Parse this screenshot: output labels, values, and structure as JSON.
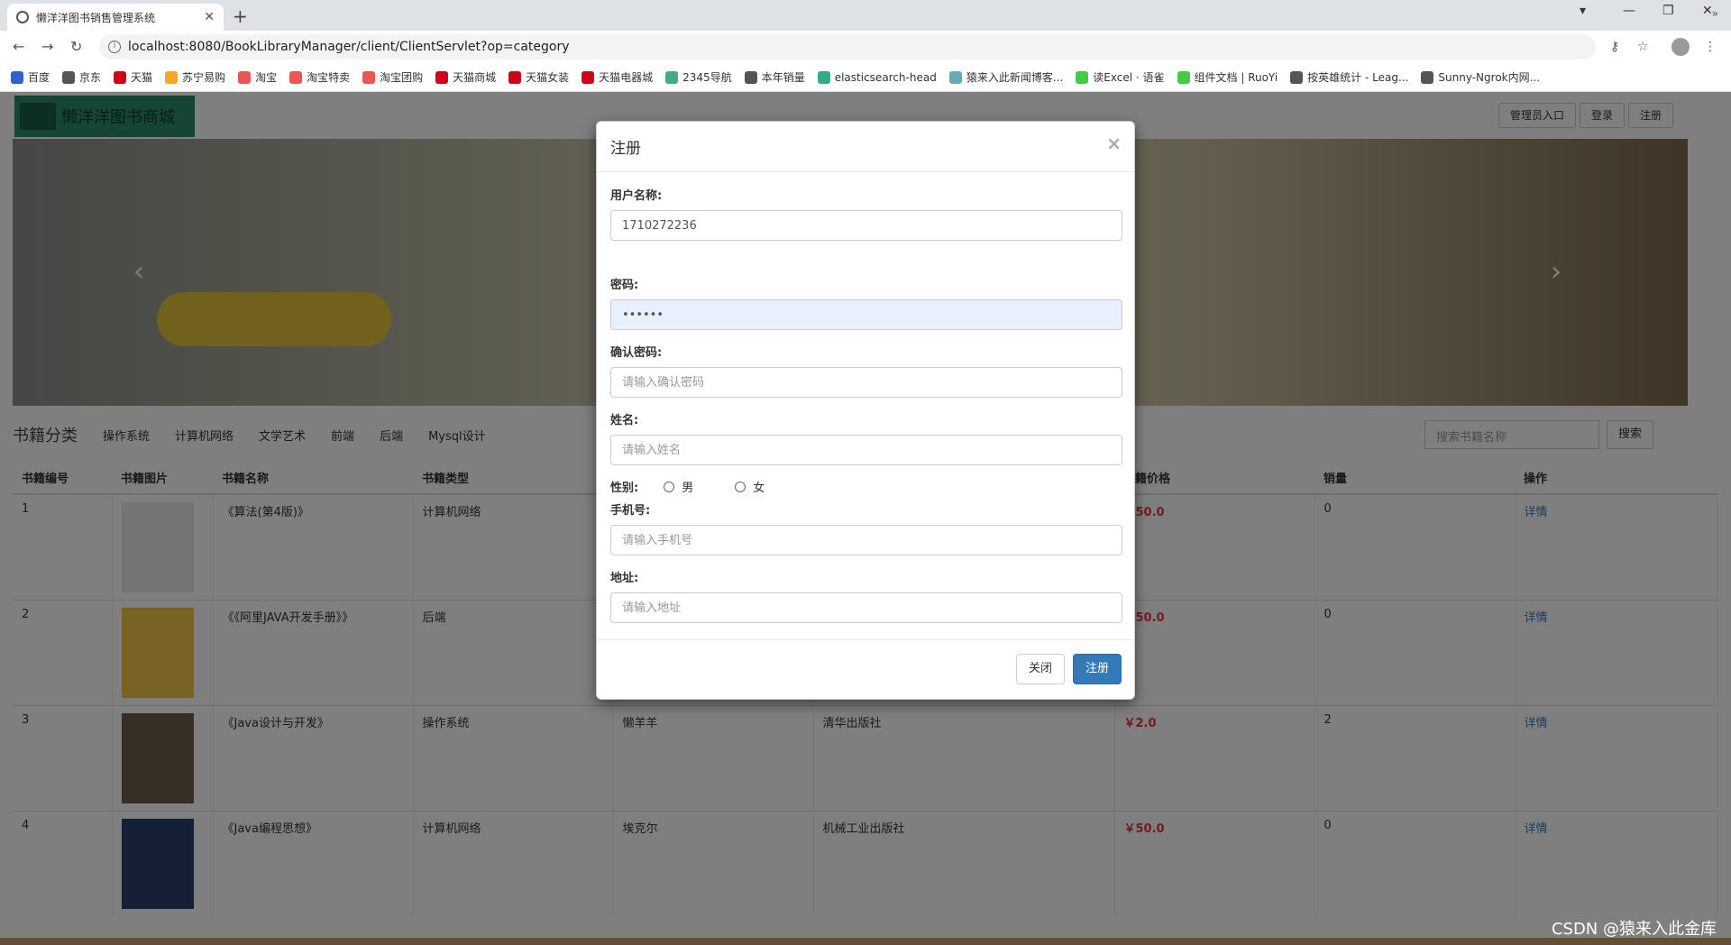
{
  "browser": {
    "tab_title": "懒洋洋图书销售管理系统",
    "url": "localhost:8080/BookLibraryManager/client/ClientServlet?op=category",
    "bookmarks": [
      "百度",
      "京东",
      "天猫",
      "苏宁易购",
      "淘宝",
      "淘宝特卖",
      "淘宝团购",
      "天猫商城",
      "天猫女装",
      "天猫电器城",
      "2345导航",
      "本年销量",
      "elasticsearch-head",
      "猿来入此新闻博客...",
      "读Excel · 语雀",
      "组件文档 | RuoYi",
      "按英雄统计 - Leag...",
      "Sunny-Ngrok内网..."
    ],
    "bookmarks_more": "»"
  },
  "site": {
    "brand": "懒洋洋图书商城",
    "admin_entry": "管理员入口",
    "login": "登录",
    "register": "注册",
    "category_heading": "书籍分类",
    "categories": [
      "操作系统",
      "计算机网络",
      "文学艺术",
      "前端",
      "后端",
      "Mysql设计"
    ],
    "search_placeholder": "搜索书籍名称",
    "search_button": "搜索",
    "table": {
      "headers": [
        "书籍编号",
        "书籍图片",
        "书籍名称",
        "书籍类型",
        "",
        "",
        "书籍价格",
        "销量",
        "操作"
      ],
      "rows": [
        {
          "id": "1",
          "name": "《算法(第4版)》",
          "type": "计算机网络",
          "author": "",
          "publisher": "",
          "price": "￥50.0",
          "sales": "0",
          "action": "详情"
        },
        {
          "id": "2",
          "name": "《《阿里JAVA开发手册》》",
          "type": "后端",
          "author": "",
          "publisher": "",
          "price": "￥50.0",
          "sales": "0",
          "action": "详情"
        },
        {
          "id": "3",
          "name": "《Java设计与开发》",
          "type": "操作系统",
          "author": "懒羊羊",
          "publisher": "清华出版社",
          "price": "￥2.0",
          "sales": "2",
          "action": "详情"
        },
        {
          "id": "4",
          "name": "《Java编程思想》",
          "type": "计算机网络",
          "author": "埃克尔",
          "publisher": "机械工业出版社",
          "price": "￥50.0",
          "sales": "0",
          "action": "详情"
        }
      ]
    }
  },
  "modal": {
    "title": "注册",
    "username_label": "用户名称:",
    "username_value": "1710272236",
    "password_label": "密码:",
    "password_value": "••••••",
    "confirm_label": "确认密码:",
    "confirm_placeholder": "请输入确认密码",
    "name_label": "姓名:",
    "name_placeholder": "请输入姓名",
    "gender_label": "性别:",
    "gender_male": "男",
    "gender_female": "女",
    "phone_label": "手机号:",
    "phone_placeholder": "请输入手机号",
    "address_label": "地址:",
    "address_placeholder": "请输入地址",
    "close_button": "关闭",
    "register_button": "注册"
  },
  "watermark": "CSDN @猿来入此金库"
}
